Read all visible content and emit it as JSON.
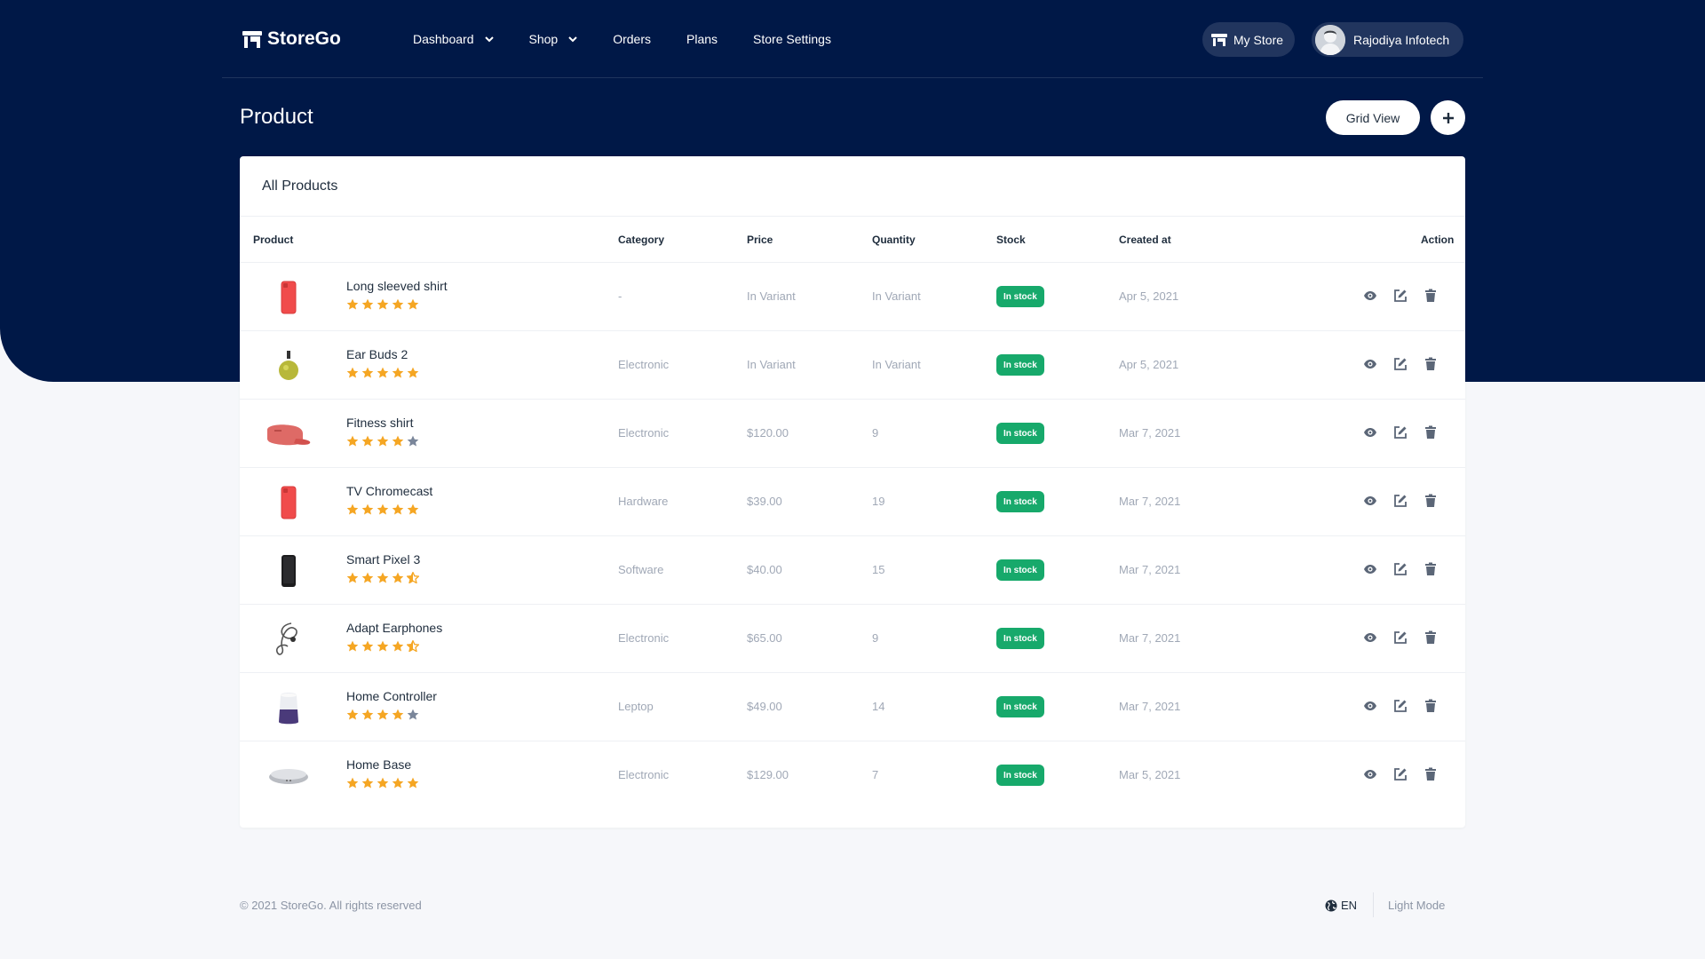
{
  "brand": {
    "name": "StoreGo"
  },
  "nav": {
    "items": [
      {
        "label": "Dashboard",
        "dropdown": true
      },
      {
        "label": "Shop",
        "dropdown": true
      },
      {
        "label": "Orders",
        "dropdown": false
      },
      {
        "label": "Plans",
        "dropdown": false
      },
      {
        "label": "Store Settings",
        "dropdown": false
      }
    ],
    "my_store": "My Store",
    "user_name": "Rajodiya Infotech"
  },
  "page": {
    "title": "Product",
    "grid_view_label": "Grid View",
    "add_icon": "plus-icon"
  },
  "card": {
    "title": "All Products",
    "columns": {
      "product": "Product",
      "category": "Category",
      "price": "Price",
      "quantity": "Quantity",
      "stock": "Stock",
      "created": "Created at",
      "action": "Action"
    }
  },
  "products": [
    {
      "name": "Long sleeved shirt",
      "rating": 5,
      "category": "-",
      "price": "In Variant",
      "quantity": "In Variant",
      "stock": "In stock",
      "created": "Apr 5, 2021",
      "thumb": "red-phone"
    },
    {
      "name": "Ear Buds 2",
      "rating": 5,
      "category": "Electronic",
      "price": "In Variant",
      "quantity": "In Variant",
      "stock": "In stock",
      "created": "Apr 5, 2021",
      "thumb": "green-bottle"
    },
    {
      "name": "Fitness shirt",
      "rating": 4,
      "category": "Electronic",
      "price": "$120.00",
      "quantity": "9",
      "stock": "In stock",
      "created": "Mar 7, 2021",
      "thumb": "red-case"
    },
    {
      "name": "TV Chromecast",
      "rating": 5,
      "category": "Hardware",
      "price": "$39.00",
      "quantity": "19",
      "stock": "In stock",
      "created": "Mar 7, 2021",
      "thumb": "red-phone"
    },
    {
      "name": "Smart Pixel 3",
      "rating": 4.5,
      "category": "Software",
      "price": "$40.00",
      "quantity": "15",
      "stock": "In stock",
      "created": "Mar 7, 2021",
      "thumb": "black-phone"
    },
    {
      "name": "Adapt Earphones",
      "rating": 4.5,
      "category": "Electronic",
      "price": "$65.00",
      "quantity": "9",
      "stock": "In stock",
      "created": "Mar 7, 2021",
      "thumb": "earphones"
    },
    {
      "name": "Home Controller",
      "rating": 4,
      "category": "Leptop",
      "price": "$49.00",
      "quantity": "14",
      "stock": "In stock",
      "created": "Mar 7, 2021",
      "thumb": "speaker"
    },
    {
      "name": "Home Base",
      "rating": 5,
      "category": "Electronic",
      "price": "$129.00",
      "quantity": "7",
      "stock": "In stock",
      "created": "Mar 5, 2021",
      "thumb": "puck"
    }
  ],
  "colors": {
    "header_bg": "#001847",
    "star_on": "#f5a623",
    "star_off": "#7a869a",
    "stock_badge": "#17a96b"
  },
  "footer": {
    "copyright": "© 2021 StoreGo. All rights reserved",
    "language": "EN",
    "mode": "Light Mode"
  }
}
